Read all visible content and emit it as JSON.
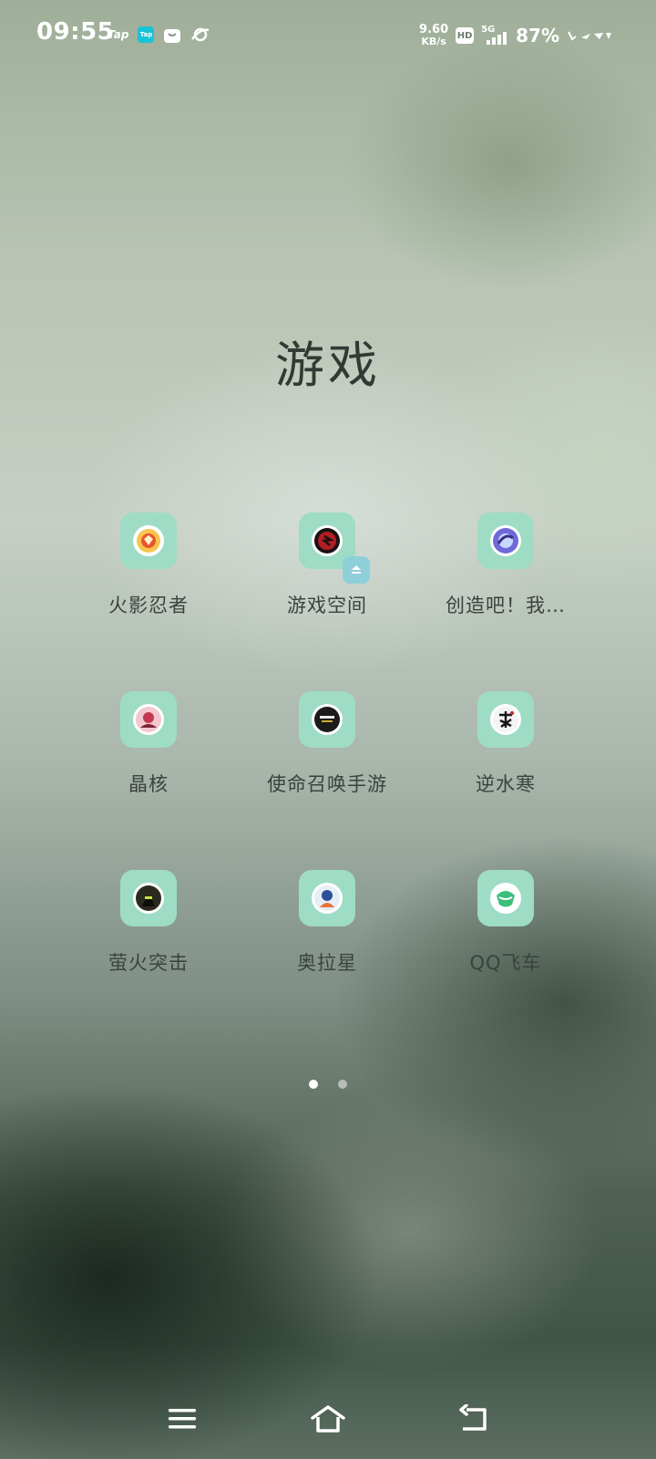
{
  "status_bar": {
    "time": "09:55",
    "tap_label": "Tap",
    "tap_badge_label": "Tap",
    "net_speed_value": "9.60",
    "net_speed_unit": "KB/s",
    "hd_label": "HD",
    "network_type": "5G",
    "battery": "87%"
  },
  "folder": {
    "title": "游戏",
    "apps": [
      {
        "label": "火影忍者"
      },
      {
        "label": "游戏空间"
      },
      {
        "label": "创造吧！我…"
      },
      {
        "label": "晶核"
      },
      {
        "label": "使命召唤手游"
      },
      {
        "label": "逆水寒"
      },
      {
        "label": "萤火突击"
      },
      {
        "label": "奥拉星"
      },
      {
        "label": "QQ飞车"
      }
    ]
  },
  "pagination": {
    "current_page": 1,
    "total_pages": 2
  },
  "colors": {
    "icon_bg": "#9fdcc5",
    "badge_bg": "#8ecfda",
    "title_text": "#333a35",
    "label_text": "#3b423d"
  },
  "nav_bar": {
    "icons": [
      "menu-icon",
      "home-icon",
      "back-icon"
    ]
  }
}
